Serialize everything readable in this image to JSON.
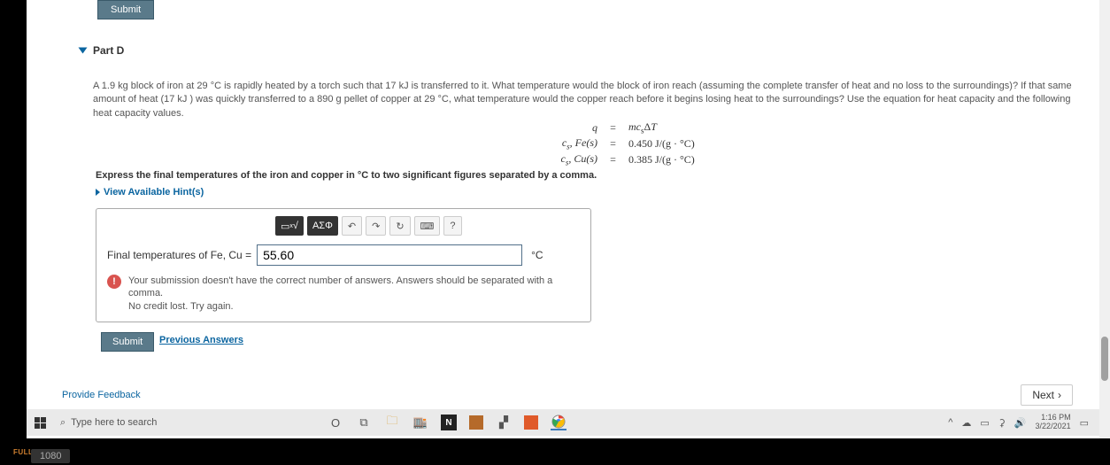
{
  "submit_top": "Submit",
  "part": {
    "label": "Part D"
  },
  "problem_text": "A 1.9 kg block of iron at 29 °C is rapidly heated by a torch such that 17 kJ is transferred to it. What temperature would the block of iron reach (assuming the complete transfer of heat and no loss to the surroundings)? If that same amount of heat (17 kJ ) was quickly transferred to a 890 g pellet of copper at 29 °C, what temperature would the copper reach before it begins losing heat to the surroundings? Use the equation for heat capacity and the following heat capacity values.",
  "eq": {
    "r1l": "q",
    "r1r": "mcₛΔT",
    "r2l": "cₛ, Fe(s)",
    "r2r": "0.450 J/(g · °C)",
    "r3l": "cₛ, Cu(s)",
    "r3r": "0.385 J/(g · °C)"
  },
  "instruction": "Express the final temperatures of the iron and copper in °C to two significant figures separated by a comma.",
  "hints_label": "View Available Hint(s)",
  "toolbar": {
    "template": "▭√▭",
    "symbols": "ΑΣΦ",
    "undo": "↶",
    "redo": "↷",
    "reset": "↻",
    "keyboard": "⌨",
    "help": "?"
  },
  "answer": {
    "label": "Final temperatures of Fe, Cu =",
    "value": "55.60",
    "unit": "°C"
  },
  "error": {
    "line1": "Your submission doesn't have the correct number of answers. Answers should be separated with a comma.",
    "line2": "No credit lost. Try again."
  },
  "submit2": "Submit",
  "prev": "Previous Answers",
  "feedback": "Provide Feedback",
  "next": "Next",
  "taskbar": {
    "search_placeholder": "Type here to search",
    "time": "1:16 PM",
    "date": "3/22/2021"
  },
  "badge": "1080",
  "full": "FULL"
}
